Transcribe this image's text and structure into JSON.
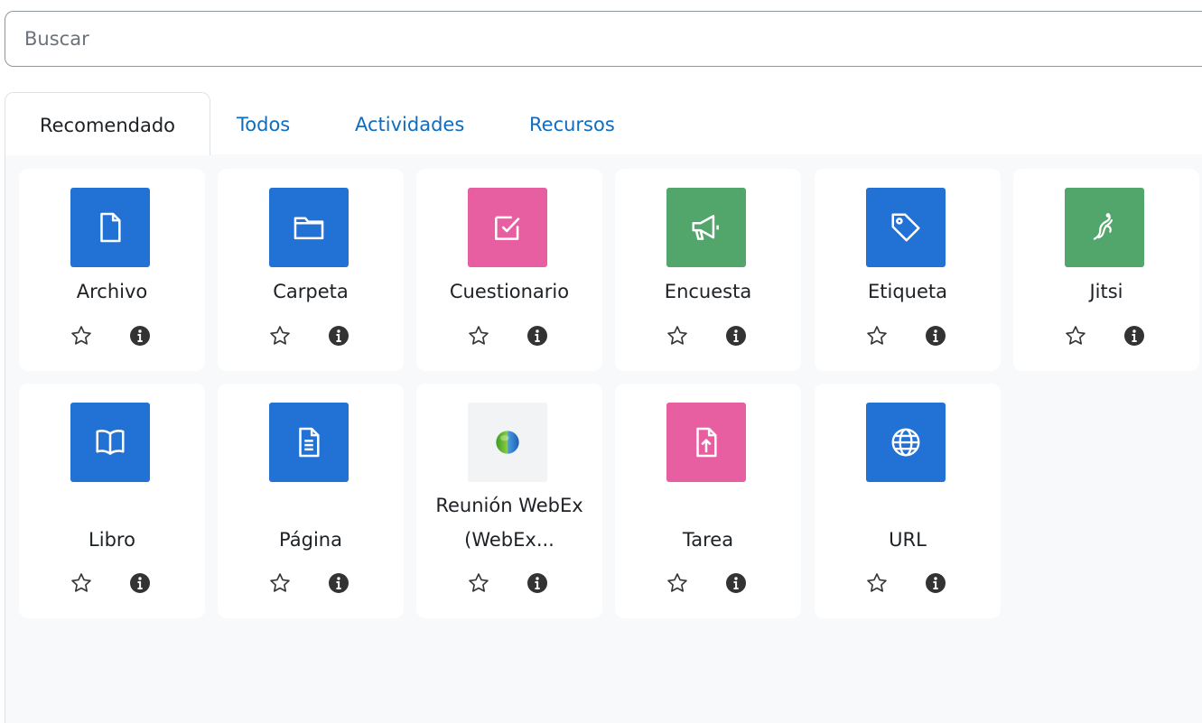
{
  "search": {
    "placeholder": "Buscar"
  },
  "tabs": [
    {
      "label": "Recomendado"
    },
    {
      "label": "Todos"
    },
    {
      "label": "Actividades"
    },
    {
      "label": "Recursos"
    }
  ],
  "modules": [
    {
      "name": "Archivo",
      "icon": "file-icon",
      "color": "#2271d4"
    },
    {
      "name": "Carpeta",
      "icon": "folder-icon",
      "color": "#2271d4"
    },
    {
      "name": "Cuestionario",
      "icon": "checkbox-icon",
      "color": "#e75fa1"
    },
    {
      "name": "Encuesta",
      "icon": "megaphone-icon",
      "color": "#52a56b"
    },
    {
      "name": "Etiqueta",
      "icon": "tag-icon",
      "color": "#2271d4"
    },
    {
      "name": "Jitsi",
      "icon": "jitsi-icon",
      "color": "#52a56b"
    },
    {
      "name": "Libro",
      "icon": "book-icon",
      "color": "#2271d4"
    },
    {
      "name": "Página",
      "icon": "page-icon",
      "color": "#2271d4"
    },
    {
      "name_line1": "Reunión WebEx",
      "name_line2": "(WebEx...",
      "icon": "webex-globe-icon"
    },
    {
      "name": "Tarea",
      "icon": "assignment-upload-icon",
      "color": "#e75fa1"
    },
    {
      "name": "URL",
      "icon": "globe-icon",
      "color": "#2271d4"
    }
  ]
}
